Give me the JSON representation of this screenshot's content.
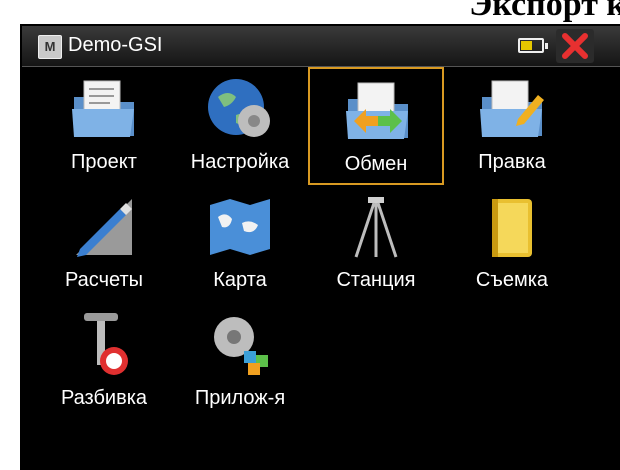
{
  "doc_heading": "Экспорт к",
  "window": {
    "title": "Demo-GSI",
    "app_icon_letter": "M",
    "battery_level": 0.55,
    "accent": "#d89a22",
    "close_color": "#e83030"
  },
  "menu": [
    {
      "label": "Проект",
      "icon": "folder-document-icon"
    },
    {
      "label": "Настройка",
      "icon": "globe-gear-icon"
    },
    {
      "label": "Обмен",
      "icon": "folder-exchange-icon",
      "selected": true
    },
    {
      "label": "Правка",
      "icon": "folder-edit-icon"
    },
    {
      "label": "Расчеты",
      "icon": "pencil-ruler-icon"
    },
    {
      "label": "Карта",
      "icon": "map-icon"
    },
    {
      "label": "Станция",
      "icon": "tripod-icon"
    },
    {
      "label": "Съемка",
      "icon": "notebook-icon"
    },
    {
      "label": "Разбивка",
      "icon": "stakeout-pin-icon"
    },
    {
      "label": "Прилож-я",
      "icon": "apps-gear-icon"
    }
  ]
}
